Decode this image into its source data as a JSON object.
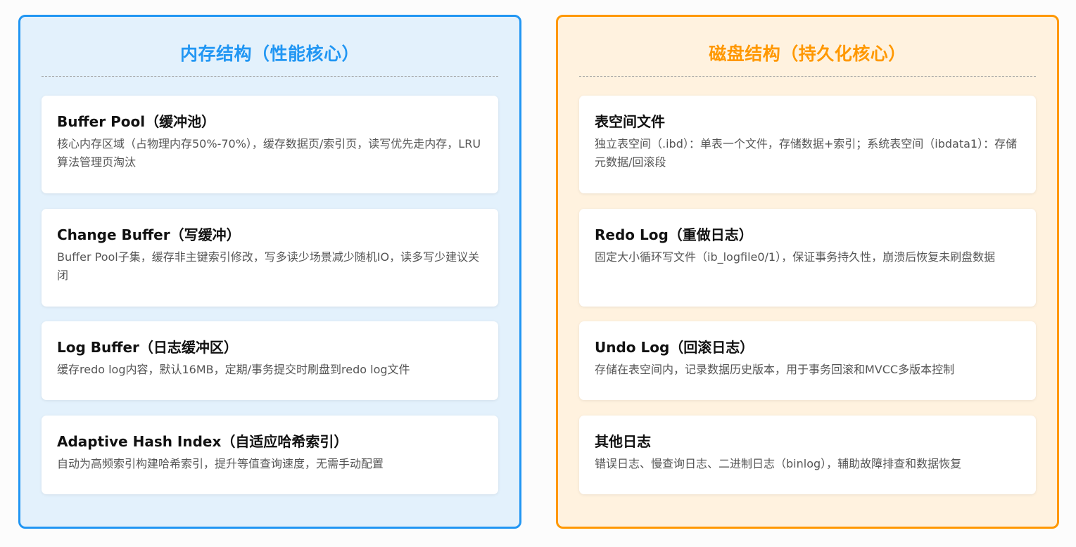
{
  "memory": {
    "title": "内存结构（性能核心）",
    "accent_color": "#2196f3",
    "background_color": "#e3f1fc",
    "cards": [
      {
        "title": "Buffer Pool（缓冲池）",
        "desc": "核心内存区域（占物理内存50%-70%），缓存数据页/索引页，读写优先走内存，LRU算法管理页淘汰"
      },
      {
        "title": "Change Buffer（写缓冲）",
        "desc": "Buffer Pool子集，缓存非主键索引修改，写多读少场景减少随机IO，读多写少建议关闭"
      },
      {
        "title": "Log Buffer（日志缓冲区）",
        "desc": "缓存redo log内容，默认16MB，定期/事务提交时刷盘到redo log文件"
      },
      {
        "title": "Adaptive Hash Index（自适应哈希索引）",
        "desc": "自动为高频索引构建哈希索引，提升等值查询速度，无需手动配置"
      }
    ]
  },
  "disk": {
    "title": "磁盘结构（持久化核心）",
    "accent_color": "#ff9800",
    "background_color": "#fff2df",
    "cards": [
      {
        "title": "表空间文件",
        "desc": "独立表空间（.ibd）：单表一个文件，存储数据+索引；系统表空间（ibdata1）：存储元数据/回滚段"
      },
      {
        "title": "Redo Log（重做日志）",
        "desc": "固定大小循环写文件（ib_logfile0/1），保证事务持久性，崩溃后恢复未刷盘数据"
      },
      {
        "title": "Undo Log（回滚日志）",
        "desc": "存储在表空间内，记录数据历史版本，用于事务回滚和MVCC多版本控制"
      },
      {
        "title": "其他日志",
        "desc": "错误日志、慢查询日志、二进制日志（binlog），辅助故障排查和数据恢复"
      }
    ]
  }
}
